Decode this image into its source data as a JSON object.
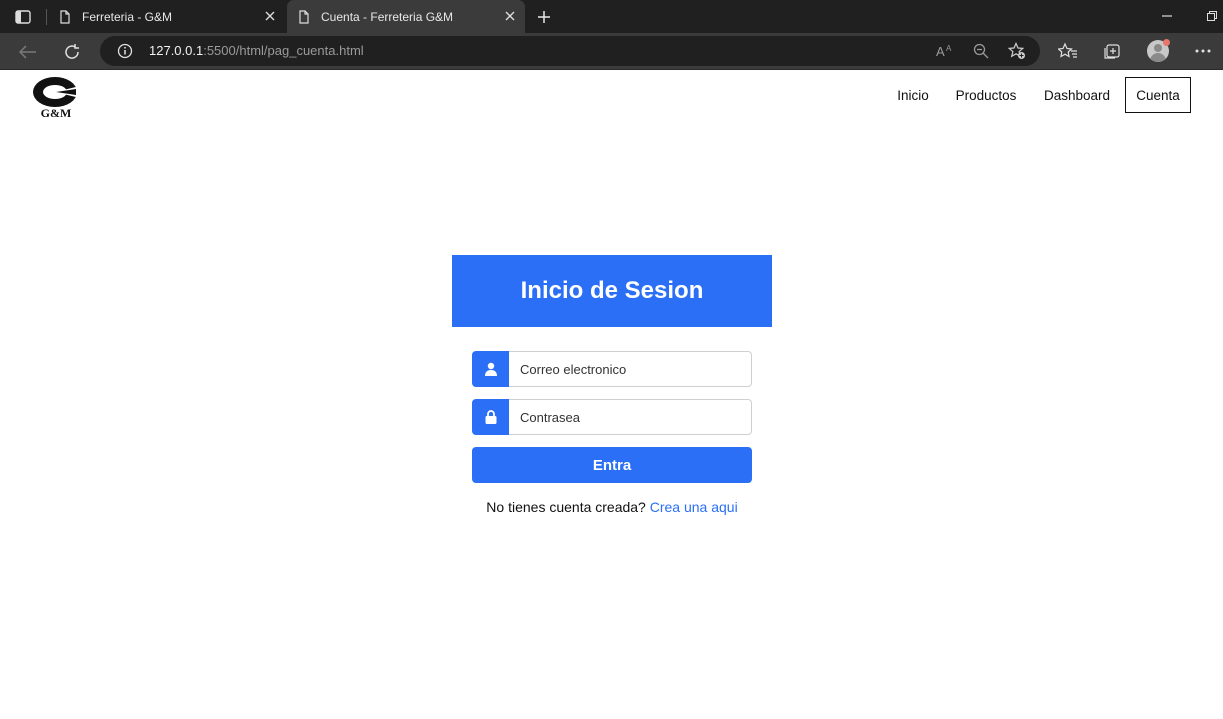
{
  "browser": {
    "tabs": [
      {
        "title": "Ferreteria - G&M",
        "active": false
      },
      {
        "title": "Cuenta - Ferreteria G&M",
        "active": true
      }
    ],
    "url": {
      "host": "127.0.0.1",
      "rest": ":5500/html/pag_cuenta.html"
    },
    "icons": {
      "tab_actions": "tab-actions-icon",
      "page": "document-icon",
      "close": "close-icon",
      "new_tab": "plus-icon",
      "back": "back-arrow-icon",
      "refresh": "refresh-icon",
      "info": "info-icon",
      "read_aloud": "read-aloud-icon",
      "zoom": "zoom-out-icon",
      "add_favorite": "add-favorite-icon",
      "favorites": "favorites-icon",
      "collections": "collections-icon",
      "profile": "avatar",
      "menu": "more-icon"
    }
  },
  "navbar": {
    "logo_text": "G&M",
    "items": [
      {
        "label": "Inicio",
        "active": false
      },
      {
        "label": "Productos",
        "active": false
      },
      {
        "label": "Dashboard",
        "active": false
      },
      {
        "label": "Cuenta",
        "active": true
      }
    ]
  },
  "login": {
    "title": "Inicio de Sesion",
    "email_placeholder": "Correo electronico",
    "password_placeholder": "Contrasea",
    "submit_label": "Entra",
    "register_prompt": "No tienes cuenta creada?",
    "register_link": "Crea una aqui"
  },
  "colors": {
    "accent": "#2a6ff5",
    "chrome_dark": "#202020",
    "chrome_mid": "#3b3b3b"
  }
}
